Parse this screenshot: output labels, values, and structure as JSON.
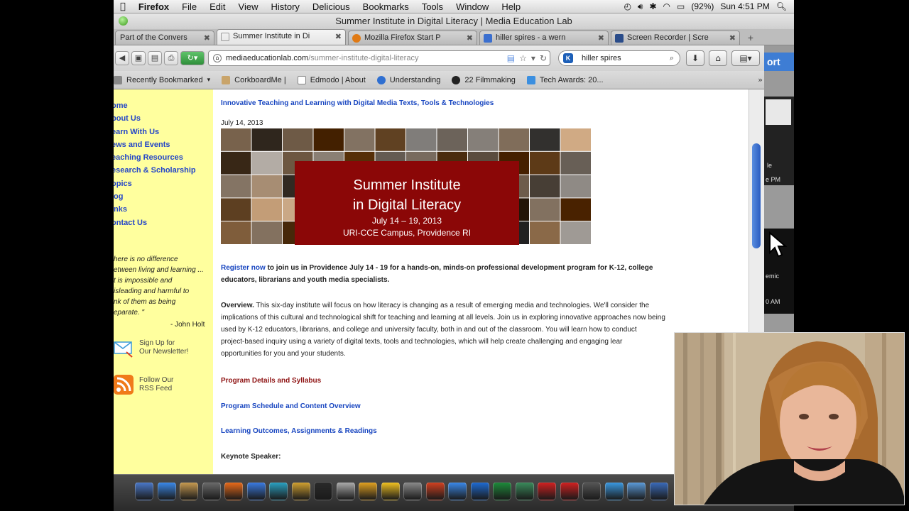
{
  "menubar": {
    "apple": "",
    "app": "Firefox",
    "items": [
      "File",
      "Edit",
      "View",
      "History",
      "Delicious",
      "Bookmarks",
      "Tools",
      "Window",
      "Help"
    ],
    "battery": "(92%)",
    "clock": "Sun 4:51 PM"
  },
  "window": {
    "title": "Summer Institute in Digital Literacy | Media Education Lab"
  },
  "tabs": [
    {
      "label": "Part of the Convers",
      "icon_color": "#7a7a7a",
      "active": false
    },
    {
      "label": "Summer Institute in Di",
      "icon_color": "#ffffff",
      "active": true
    },
    {
      "label": "Mozilla Firefox Start P",
      "icon_color": "#e07a14",
      "active": false
    },
    {
      "label": "hiller spires - a wern",
      "icon_color": "#3b6fcf",
      "active": false
    },
    {
      "label": "Screen Recorder | Scre",
      "icon_color": "#2a4c8a",
      "active": false
    }
  ],
  "newtab": "+",
  "url": {
    "host": "mediaeducationlab.com",
    "path": "/summer-institute-digital-literacy"
  },
  "search": {
    "value": "hiller spires",
    "engine": "K"
  },
  "bookmarks": [
    {
      "label": "Recently Bookmarked",
      "icon_color": "#888888"
    },
    {
      "label": "CorkboardMe |",
      "icon_color": "#c9a46a"
    },
    {
      "label": "Edmodo | About",
      "icon_color": "#ffffff"
    },
    {
      "label": "Understanding",
      "icon_color": "#2f6fd1"
    },
    {
      "label": "22 Filmmaking",
      "icon_color": "#222222"
    },
    {
      "label": "Tech Awards: 20...",
      "icon_color": "#3b8fe0"
    }
  ],
  "sidebar": {
    "nav": [
      "ome",
      "bout Us",
      "earn With Us",
      "ews and Events",
      "eaching Resources",
      "esearch & Scholarship",
      "opics",
      "log",
      "inks",
      "ontact Us"
    ],
    "quote_lines": [
      "here is no difference",
      "etween living and learning ...",
      "t is impossible and",
      "isleading and harmful to",
      "nk of them as being",
      "eparate. \""
    ],
    "quote_author": "- John Holt",
    "newsletter_lines": [
      "Sign Up for",
      "Our Newsletter!"
    ],
    "rss_lines": [
      "Follow Our",
      "RSS Feed"
    ]
  },
  "content": {
    "heading": "Innovative Teaching and Learning with Digital Media Texts, Tools & Technologies",
    "date": "July 14, 2013",
    "banner": {
      "title_line1": "Summer Institute",
      "title_line2": "in Digital Literacy",
      "dates": "July 14 – 19, 2013",
      "location": "URI-CCE Campus, Providence RI"
    },
    "register_link": "Register now",
    "register_text_1": " to join us in Providence July 14 - 19 for a hands-on, minds-on professional development program for K-12, college",
    "register_text_2": "educators, librarians and youth media specialists.",
    "overview_label": "Overview.",
    "overview_line1": " This six-day institute will focus on how literacy is changing as a result of emerging media and technologies. We'll consider the",
    "overview_line2": "implications of this cultural and technological shift for teaching and learning at all levels. Join us in exploring innovative approaches now being",
    "overview_line3": "used by K-12 educators, librarians, and college and university faculty, both in and out of the classroom. You will learn how to conduct",
    "overview_line4": "project-based inquiry using a variety of digital texts, tools and technologies, which will help create challenging and engaging lear",
    "overview_line5": "opportunities for you and your students.",
    "program_details": "Program Details and Syllabus",
    "schedule_link": "Program Schedule and Content Overview",
    "outcomes_link": "Learning Outcomes, Assignments & Readings",
    "keynote": "Keynote Speaker:"
  },
  "rightstrip": {
    "support": "ort",
    "a_lines": [
      "le",
      "e PM"
    ],
    "b_lines": [
      "emic",
      "0 AM"
    ]
  },
  "dock": {
    "icon_colors": [
      "#4a78c8",
      "#3a88e8",
      "#c69a50",
      "#6a6a6a",
      "#e86a1a",
      "#3a7ae0",
      "#2aa0c0",
      "#d0a030",
      "#2a2a2a",
      "#aaaaaa",
      "#e0a020",
      "#f0c020",
      "#8a8a8a",
      "#d04020",
      "#3a88e8",
      "#1e6ad0",
      "#1d8a3a",
      "#3a8a5a",
      "#d02020",
      "#d02020",
      "#555555",
      "#3a98e0",
      "#5a9ad8",
      "#3a6ab8"
    ]
  }
}
